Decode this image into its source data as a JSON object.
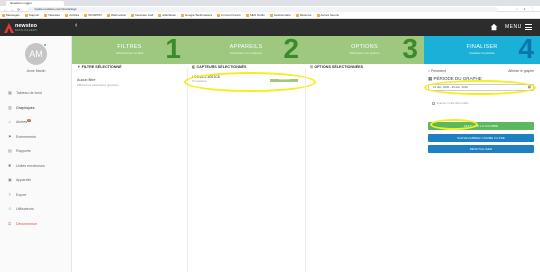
{
  "browser": {
    "tab_title": "Newsteo Logger",
    "url": "mysite.newsteo.com/charts/logs",
    "bookmarks": [
      "Messages",
      "Support",
      "Newsteo",
      "Articles",
      "WinSPRO",
      "Webmotion",
      "Newsteo mail",
      "adsclassé",
      "Google Webmasters",
      "Formel Francs",
      "SEO Outils",
      "Gestionnaire",
      "Mesures",
      "Autres favoris"
    ]
  },
  "header": {
    "logo_text": "newsteo",
    "logo_sub": "DATALOGGERS",
    "menu_label": "MENU"
  },
  "user": {
    "avatar_initials": "AM",
    "name": "Anne Martin"
  },
  "sidebar": {
    "items": [
      {
        "label": "Tableau de bord",
        "icon": "dashboard-icon"
      },
      {
        "label": "Graphiques",
        "icon": "chart-icon"
      },
      {
        "label": "Alertes",
        "icon": "bell-icon",
        "badge": "3"
      },
      {
        "label": "Evénements",
        "icon": "flag-icon"
      },
      {
        "label": "Rapports",
        "icon": "file-icon"
      },
      {
        "label": "Unités enroleuses",
        "icon": "settings-icon"
      },
      {
        "label": "Appareils",
        "icon": "device-icon"
      },
      {
        "label": "Export",
        "icon": "export-icon"
      },
      {
        "label": "Utilisateurs",
        "icon": "users-icon"
      },
      {
        "label": "Déconnexion",
        "icon": "power-icon"
      }
    ]
  },
  "steps": [
    {
      "title": "FILTRES",
      "subtitle": "Sélectionnez un filtre",
      "number": "1"
    },
    {
      "title": "APPAREILS",
      "subtitle": "Choisissez vos capteurs",
      "number": "2"
    },
    {
      "title": "OPTIONS",
      "subtitle": "Définissez vos options",
      "number": "3"
    },
    {
      "title": "FINALISER",
      "subtitle": "Finaliser la période",
      "number": "4"
    }
  ],
  "filter_panel": {
    "heading": "FILTRE SÉLECTIONNÉ",
    "item_title": "Aucun filtre",
    "item_desc": "Affichez les paramètres généraux"
  },
  "sensor_panel": {
    "heading": "CAPTEURS SÉLECTIONNÉS",
    "sensor_name": "LOG16-2 3001C8",
    "sensor_sub": "Température",
    "tag": "Température"
  },
  "options_panel": {
    "heading": "OPTIONS SÉLECTIONNÉES"
  },
  "finalize": {
    "prev_label": "< Précédent",
    "show_label": "Afficher le graphe",
    "period_heading": "PÉRIODE DU GRAPHE",
    "period_value": "15 déc. 2020 - 29 déc. 2020",
    "checkbox_label": "Enlever l'unité filtré public",
    "btn_display": "AFFICHER LA COURBE",
    "btn_save_filter": "SAUVEGARDER COMME FILTRE",
    "btn_reset": "RÉINITIALISER"
  },
  "colors": {
    "step_green": "#9ec87f",
    "step_blue": "#1ab0d8",
    "highlight": "#f5ee1c",
    "button_green": "#5cb85c",
    "button_blue": "#1e7fc3"
  }
}
